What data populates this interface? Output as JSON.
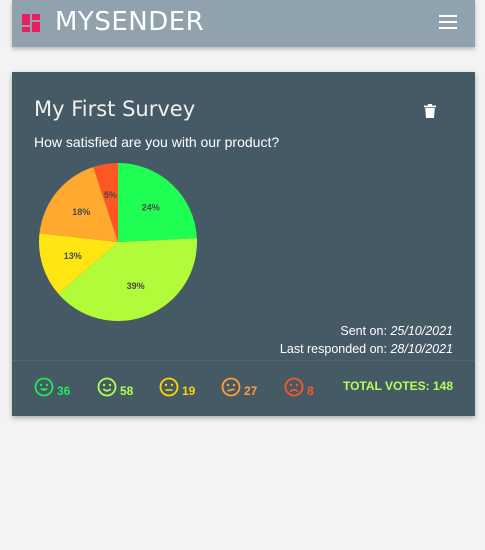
{
  "app": {
    "brand": "MYSENDER"
  },
  "survey": {
    "title": "My First Survey",
    "question": "How satisfied are you with our product?",
    "sent_label": "Sent on:",
    "sent_date": "25/10/2021",
    "responded_label": "Last responded on:",
    "responded_date": "28/10/2021"
  },
  "chart_data": {
    "type": "pie",
    "slices": [
      {
        "label": "24%",
        "value": 24,
        "color": "#1fff53"
      },
      {
        "label": "39%",
        "value": 39,
        "color": "#b2fb3a"
      },
      {
        "label": "13%",
        "value": 13,
        "color": "#ffe512"
      },
      {
        "label": "18%",
        "value": 18,
        "color": "#ffa92e"
      },
      {
        "label": "5%",
        "value": 5,
        "color": "#ff5722"
      }
    ]
  },
  "votes": [
    {
      "icon": "very-happy-face-icon",
      "count": "36",
      "color": "#1fe95a"
    },
    {
      "icon": "happy-face-icon",
      "count": "58",
      "color": "#b2ff59"
    },
    {
      "icon": "neutral-face-icon",
      "count": "19",
      "color": "#ffd600"
    },
    {
      "icon": "unhappy-face-icon",
      "count": "27",
      "color": "#ff9f36"
    },
    {
      "icon": "sad-face-icon",
      "count": "8",
      "color": "#ff5722"
    }
  ],
  "total_votes_label": "TOTAL VOTES: 148",
  "colors": {
    "navbar": "#8fa2ae",
    "card": "#455a64",
    "accent": "#e91e63"
  }
}
